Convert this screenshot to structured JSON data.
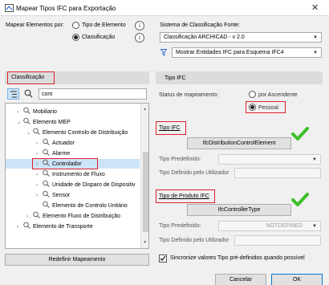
{
  "window": {
    "title": "Mapear Tipos IFC para Exportação"
  },
  "mapping": {
    "label": "Mapear Elementos por:",
    "option_element_type": "Tipo de Elemento",
    "option_classification": "Classificação",
    "selected": "Classificação"
  },
  "source_system": {
    "label": "Sistema de Classificação Fonte:",
    "value": "Classificação ARCHICAD - v 2.0",
    "filter_value": "Mostrar Entidades IFC para Esquema IFC4"
  },
  "left_panel": {
    "header": "Classificação",
    "search_value": "cont",
    "tree": [
      {
        "label": "Mobiliario",
        "level": 0,
        "toggle": "›"
      },
      {
        "label": "Elemento MEP",
        "level": 0,
        "toggle": "⌄"
      },
      {
        "label": "Elemento Controlo de Distribuição",
        "level": 1,
        "toggle": "⌄"
      },
      {
        "label": "Actuador",
        "level": 2,
        "toggle": "›"
      },
      {
        "label": "Alarme",
        "level": 2,
        "toggle": "›"
      },
      {
        "label": "Controlador",
        "level": 2,
        "toggle": "›"
      },
      {
        "label": "Instrumento de Fluxo",
        "level": 2,
        "toggle": "›"
      },
      {
        "label": "Unidade de Disparo de Dispositiv",
        "level": 2,
        "toggle": "›"
      },
      {
        "label": "Sensor",
        "level": 2,
        "toggle": "›"
      },
      {
        "label": "Elemento de Controlo Unitário",
        "level": 2,
        "toggle": ""
      },
      {
        "label": "Elemento Fluxo de Distribuição",
        "level": 1,
        "toggle": "›"
      },
      {
        "label": "Elemento de Transporte",
        "level": 0,
        "toggle": "›"
      }
    ],
    "reset_button": "Redefinir Mapeamento"
  },
  "right_panel": {
    "header": "Tipo IFC",
    "mapping_status_label": "Status de mapeamento:",
    "by_ascendant": "por Ascendente",
    "personal": "Pessoal",
    "ifc_type": {
      "label": "Tipo IFC",
      "value": "IfcDistributionControlElement",
      "predefined_label": "Tipo Predefinido:",
      "predefined_value": "",
      "user_defined_label": "Tipo Definido pelo Utilizador"
    },
    "product_type": {
      "label": "Tipo de Produto IFC",
      "value": "IfcControllerType",
      "predefined_label": "Tipo Predefinido:",
      "predefined_value": "NOTDEFINED",
      "user_defined_label": "Tipo Definido pelo Utilizador"
    },
    "sync_checkbox": "Sincronize valores Tipo pré-definidos quando possível",
    "sync_checked": true
  },
  "footer": {
    "cancel": "Cancelar",
    "ok": "OK"
  },
  "colors": {
    "highlight_red": "#e0202a",
    "check_green": "#3cbf28",
    "selection_blue": "#cce4f7"
  }
}
